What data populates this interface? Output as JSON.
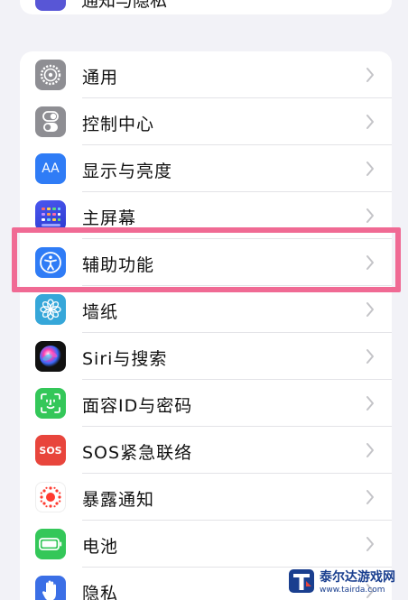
{
  "top_item": {
    "label": "通知与隐私",
    "icon": "app-icon",
    "color": "#5856d6"
  },
  "settings": {
    "items": [
      {
        "label": "通用",
        "icon": "gear-icon",
        "color": "#8e8e93"
      },
      {
        "label": "控制中心",
        "icon": "toggle-icon",
        "color": "#8e8e93"
      },
      {
        "label": "显示与亮度",
        "icon": "aa-icon",
        "color": "#2f7cf6",
        "glyph": "AA"
      },
      {
        "label": "主屏幕",
        "icon": "home-grid-icon",
        "color": "#3b55e6"
      },
      {
        "label": "辅助功能",
        "icon": "accessibility-icon",
        "color": "#2f7cf6"
      },
      {
        "label": "墙纸",
        "icon": "flower-icon",
        "color": "#36a7d9"
      },
      {
        "label": "Siri与搜索",
        "icon": "siri-icon",
        "color": "#222222"
      },
      {
        "label": "面容ID与密码",
        "icon": "faceid-icon",
        "color": "#34c759"
      },
      {
        "label": "SOS紧急联络",
        "icon": "sos-icon",
        "color": "#e8453c",
        "glyph": "SOS"
      },
      {
        "label": "暴露通知",
        "icon": "exposure-icon",
        "color": "#ffffff"
      },
      {
        "label": "电池",
        "icon": "battery-icon",
        "color": "#34c759"
      },
      {
        "label": "隐私",
        "icon": "hand-icon",
        "color": "#3b6fe6"
      }
    ]
  },
  "highlight_color": "#f06a94",
  "watermark": {
    "title": "泰尔达游戏网",
    "url": "www.tairda.com"
  }
}
